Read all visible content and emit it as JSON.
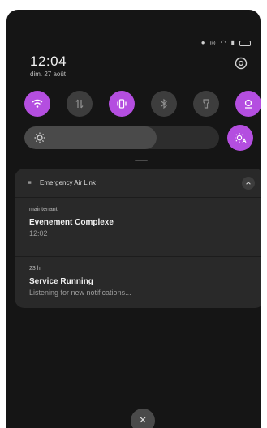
{
  "status_bar": {
    "icons": [
      "notification-icon",
      "alarm-icon",
      "wifi-icon",
      "signal-icon",
      "battery-icon"
    ]
  },
  "header": {
    "clock": "12:04",
    "date": "dim. 27 août"
  },
  "quick_tiles": [
    {
      "icon": "wifi-icon",
      "state": "on"
    },
    {
      "icon": "data-transfer-icon",
      "state": "off"
    },
    {
      "icon": "vibrate-icon",
      "state": "on"
    },
    {
      "icon": "bluetooth-icon",
      "state": "off"
    },
    {
      "icon": "flashlight-icon",
      "state": "off"
    },
    {
      "icon": "location-icon",
      "state": "on"
    }
  ],
  "brightness": {
    "level": 0.68,
    "icon": "brightness-icon",
    "auto_icon": "auto-brightness-icon"
  },
  "notification_group": {
    "app_name": "Emergency Air Link",
    "items": [
      {
        "time": "maintenant",
        "title": "Evenement Complexe",
        "body": "12:02"
      },
      {
        "time": "23 h",
        "title": "Service Running",
        "body": "Listening for new notifications..."
      }
    ]
  },
  "close_label": "×",
  "colors": {
    "accent": "#b44ee0",
    "panel": "#151515",
    "card": "#292929",
    "tile_off": "#3d3d3d"
  }
}
